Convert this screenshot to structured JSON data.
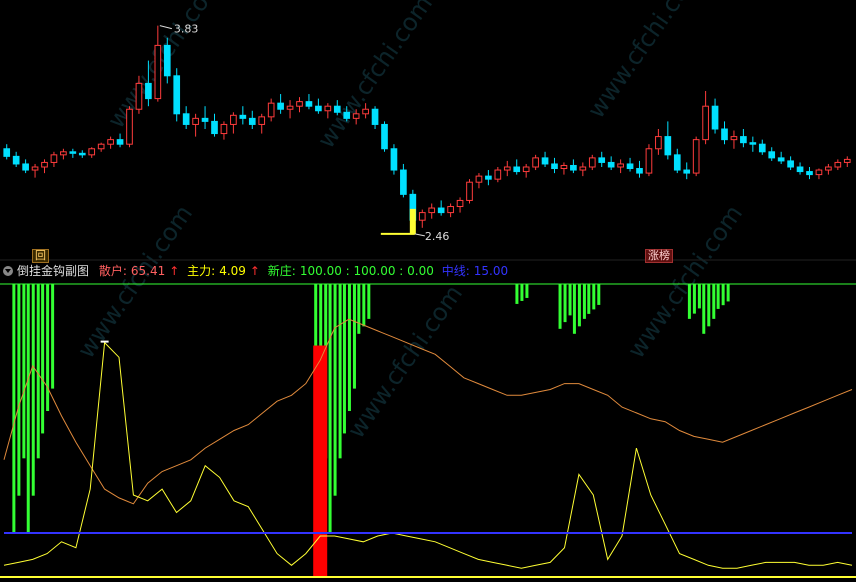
{
  "indicator_header": {
    "title": "倒挂金钩副图",
    "sanhu_label": "散户:",
    "sanhu_value": "65.41",
    "zhuli_label": "主力:",
    "zhuli_value": "4.09",
    "xinzhuang_label": "新庄:",
    "xinzhuang_values": "100.00 : 100.00 : 0.00",
    "zhongxian_label": "中线:",
    "zhongxian_value": "15.00"
  },
  "price_panel": {
    "high_label": "3.83",
    "low_label": "2.46",
    "tag_left": "回",
    "tag_right": "涨榜"
  },
  "watermark": "www.cfchi.com",
  "colors": {
    "up": "#ff3c3c",
    "down": "#00e0ff",
    "yellow": "#ffff33",
    "orange": "#e08a3c",
    "green": "#33ff33",
    "blue": "#0000ff",
    "red_bar": "#ff0000",
    "sanhu": "#ff6060",
    "zhuli": "#ffff00",
    "xinzhuang": "#33ff33",
    "zhongxian": "#3333ff"
  },
  "chart_data": [
    {
      "type": "candlestick",
      "title": "",
      "y_range": [
        2.4,
        3.9
      ],
      "annotations": [
        {
          "label": "3.83",
          "value": 3.83
        },
        {
          "label": "2.46",
          "value": 2.46
        }
      ],
      "candles_ohlc": [
        [
          3.02,
          3.05,
          2.95,
          2.97
        ],
        [
          2.97,
          3.0,
          2.9,
          2.92
        ],
        [
          2.92,
          2.95,
          2.86,
          2.88
        ],
        [
          2.88,
          2.92,
          2.83,
          2.9
        ],
        [
          2.9,
          2.95,
          2.86,
          2.93
        ],
        [
          2.93,
          3.0,
          2.9,
          2.98
        ],
        [
          2.98,
          3.02,
          2.95,
          3.0
        ],
        [
          3.0,
          3.02,
          2.96,
          2.99
        ],
        [
          2.99,
          3.01,
          2.96,
          2.98
        ],
        [
          2.98,
          3.03,
          2.96,
          3.02
        ],
        [
          3.02,
          3.06,
          3.0,
          3.05
        ],
        [
          3.05,
          3.1,
          3.02,
          3.08
        ],
        [
          3.08,
          3.12,
          3.03,
          3.05
        ],
        [
          3.05,
          3.3,
          3.03,
          3.28
        ],
        [
          3.28,
          3.5,
          3.25,
          3.45
        ],
        [
          3.45,
          3.6,
          3.3,
          3.35
        ],
        [
          3.35,
          3.83,
          3.33,
          3.7
        ],
        [
          3.7,
          3.75,
          3.45,
          3.5
        ],
        [
          3.5,
          3.55,
          3.2,
          3.25
        ],
        [
          3.25,
          3.3,
          3.15,
          3.18
        ],
        [
          3.18,
          3.25,
          3.1,
          3.22
        ],
        [
          3.22,
          3.3,
          3.15,
          3.2
        ],
        [
          3.2,
          3.25,
          3.1,
          3.12
        ],
        [
          3.12,
          3.2,
          3.08,
          3.18
        ],
        [
          3.18,
          3.26,
          3.12,
          3.24
        ],
        [
          3.24,
          3.3,
          3.18,
          3.22
        ],
        [
          3.22,
          3.27,
          3.15,
          3.18
        ],
        [
          3.18,
          3.25,
          3.12,
          3.23
        ],
        [
          3.23,
          3.35,
          3.2,
          3.32
        ],
        [
          3.32,
          3.38,
          3.25,
          3.28
        ],
        [
          3.28,
          3.34,
          3.22,
          3.3
        ],
        [
          3.3,
          3.36,
          3.26,
          3.33
        ],
        [
          3.33,
          3.38,
          3.28,
          3.3
        ],
        [
          3.3,
          3.35,
          3.25,
          3.27
        ],
        [
          3.27,
          3.32,
          3.22,
          3.3
        ],
        [
          3.3,
          3.34,
          3.24,
          3.26
        ],
        [
          3.26,
          3.3,
          3.2,
          3.22
        ],
        [
          3.22,
          3.28,
          3.18,
          3.25
        ],
        [
          3.25,
          3.32,
          3.22,
          3.28
        ],
        [
          3.28,
          3.3,
          3.15,
          3.18
        ],
        [
          3.18,
          3.2,
          3.0,
          3.02
        ],
        [
          3.02,
          3.05,
          2.85,
          2.88
        ],
        [
          2.88,
          2.92,
          2.7,
          2.72
        ],
        [
          2.72,
          2.75,
          2.46,
          2.55
        ],
        [
          2.55,
          2.62,
          2.5,
          2.6
        ],
        [
          2.6,
          2.66,
          2.56,
          2.63
        ],
        [
          2.63,
          2.68,
          2.58,
          2.6
        ],
        [
          2.6,
          2.66,
          2.57,
          2.64
        ],
        [
          2.64,
          2.7,
          2.6,
          2.68
        ],
        [
          2.68,
          2.82,
          2.66,
          2.8
        ],
        [
          2.8,
          2.86,
          2.76,
          2.84
        ],
        [
          2.84,
          2.88,
          2.78,
          2.82
        ],
        [
          2.82,
          2.9,
          2.8,
          2.88
        ],
        [
          2.88,
          2.94,
          2.84,
          2.9
        ],
        [
          2.9,
          2.95,
          2.85,
          2.87
        ],
        [
          2.87,
          2.92,
          2.83,
          2.9
        ],
        [
          2.9,
          2.98,
          2.88,
          2.96
        ],
        [
          2.96,
          3.0,
          2.9,
          2.92
        ],
        [
          2.92,
          2.96,
          2.86,
          2.89
        ],
        [
          2.89,
          2.93,
          2.85,
          2.91
        ],
        [
          2.91,
          2.95,
          2.86,
          2.88
        ],
        [
          2.88,
          2.93,
          2.84,
          2.9
        ],
        [
          2.9,
          2.98,
          2.88,
          2.96
        ],
        [
          2.96,
          3.0,
          2.9,
          2.93
        ],
        [
          2.93,
          2.97,
          2.88,
          2.9
        ],
        [
          2.9,
          2.95,
          2.86,
          2.92
        ],
        [
          2.92,
          2.96,
          2.87,
          2.89
        ],
        [
          2.89,
          2.94,
          2.83,
          2.86
        ],
        [
          2.86,
          3.05,
          2.84,
          3.02
        ],
        [
          3.02,
          3.15,
          2.98,
          3.1
        ],
        [
          3.1,
          3.2,
          2.95,
          2.98
        ],
        [
          2.98,
          3.02,
          2.86,
          2.88
        ],
        [
          2.88,
          2.93,
          2.82,
          2.86
        ],
        [
          2.86,
          3.1,
          2.84,
          3.08
        ],
        [
          3.08,
          3.4,
          3.05,
          3.3
        ],
        [
          3.3,
          3.35,
          3.12,
          3.15
        ],
        [
          3.15,
          3.2,
          3.05,
          3.08
        ],
        [
          3.08,
          3.14,
          3.02,
          3.1
        ],
        [
          3.1,
          3.15,
          3.03,
          3.06
        ],
        [
          3.06,
          3.1,
          3.0,
          3.05
        ],
        [
          3.05,
          3.08,
          2.98,
          3.0
        ],
        [
          3.0,
          3.03,
          2.94,
          2.96
        ],
        [
          2.96,
          3.0,
          2.92,
          2.94
        ],
        [
          2.94,
          2.97,
          2.88,
          2.9
        ],
        [
          2.9,
          2.93,
          2.85,
          2.87
        ],
        [
          2.87,
          2.9,
          2.82,
          2.85
        ],
        [
          2.85,
          2.89,
          2.82,
          2.88
        ],
        [
          2.88,
          2.92,
          2.85,
          2.9
        ],
        [
          2.9,
          2.95,
          2.88,
          2.93
        ],
        [
          2.93,
          2.97,
          2.9,
          2.95
        ]
      ]
    },
    {
      "type": "line",
      "title": "倒挂金钩副图",
      "y_range": [
        0,
        100
      ],
      "series": [
        {
          "name": "散户",
          "color": "#e08a3c",
          "values": [
            40,
            58,
            72,
            65,
            55,
            46,
            38,
            30,
            27,
            25,
            32,
            36,
            38,
            40,
            44,
            47,
            50,
            52,
            56,
            60,
            62,
            66,
            74,
            85,
            88,
            86,
            84,
            82,
            80,
            78,
            76,
            72,
            68,
            66,
            64,
            62,
            62,
            63,
            64,
            66,
            66,
            64,
            62,
            58,
            56,
            54,
            53,
            50,
            48,
            47,
            46,
            48,
            50,
            52,
            54,
            56,
            58,
            60,
            62,
            64
          ]
        },
        {
          "name": "主力",
          "color": "#ffff33",
          "values": [
            4,
            5,
            6,
            8,
            12,
            10,
            30,
            80,
            75,
            28,
            26,
            30,
            22,
            26,
            38,
            34,
            26,
            24,
            16,
            8,
            4,
            8,
            14,
            14,
            13,
            12,
            14,
            15,
            14,
            13,
            12,
            10,
            8,
            6,
            5,
            4,
            3,
            4,
            5,
            10,
            35,
            28,
            6,
            14,
            44,
            28,
            18,
            8,
            6,
            4,
            3,
            3,
            4,
            5,
            5,
            5,
            4,
            4,
            5,
            4
          ]
        },
        {
          "name": "新庄",
          "color": "#33ff33",
          "values": [
            0,
            100,
            100,
            60,
            0,
            0,
            0,
            0,
            0,
            0,
            0,
            0,
            0,
            0,
            0,
            0,
            0,
            0,
            0,
            0,
            0,
            0,
            100,
            100,
            60,
            20,
            0,
            0,
            0,
            0,
            0,
            0,
            0,
            0,
            0,
            0,
            8,
            0,
            0,
            18,
            20,
            12,
            0,
            0,
            0,
            0,
            0,
            0,
            14,
            20,
            10,
            0,
            0,
            0,
            0,
            0,
            0,
            0,
            0,
            0
          ]
        },
        {
          "name": "中线",
          "color": "#3333ff",
          "values": [
            15,
            15,
            15,
            15,
            15,
            15,
            15,
            15,
            15,
            15,
            15,
            15,
            15,
            15,
            15,
            15,
            15,
            15,
            15,
            15,
            15,
            15,
            15,
            15,
            15,
            15,
            15,
            15,
            15,
            15,
            15,
            15,
            15,
            15,
            15,
            15,
            15,
            15,
            15,
            15,
            15,
            15,
            15,
            15,
            15,
            15,
            15,
            15,
            15,
            15,
            15,
            15,
            15,
            15,
            15,
            15,
            15,
            15,
            15,
            15
          ]
        }
      ]
    }
  ]
}
